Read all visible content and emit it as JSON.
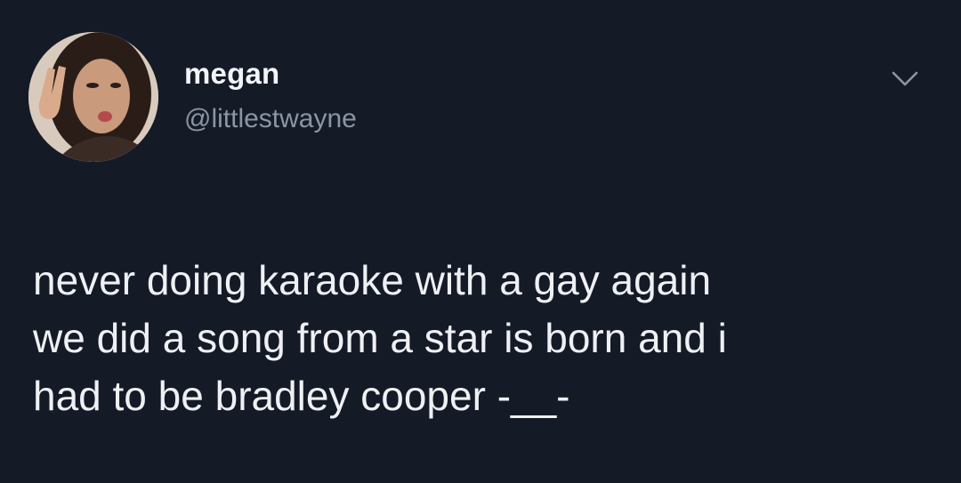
{
  "tweet": {
    "author": {
      "display_name": "megan",
      "handle": "@littlestwayne",
      "avatar_icon": "user-photo"
    },
    "menu_icon": "chevron-down-icon",
    "text_lines": [
      "never doing karaoke with a gay again",
      "we did a song from a star is born and i",
      "had to be bradley cooper -__-"
    ]
  },
  "colors": {
    "background": "#151a27",
    "text": "#eef0f3",
    "secondary_text": "#8b95a3"
  }
}
